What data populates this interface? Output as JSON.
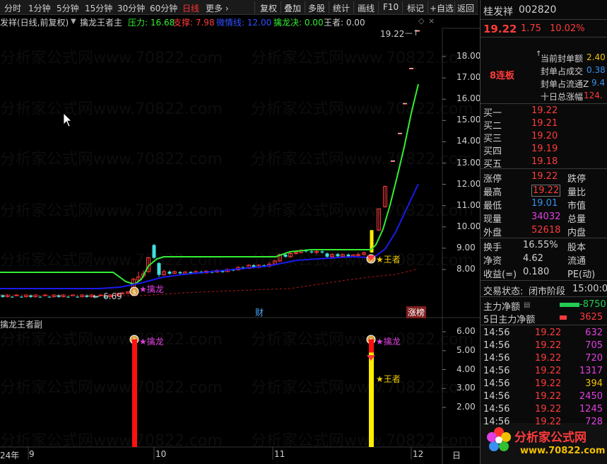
{
  "toolbar": {
    "timeframes": [
      "分时",
      "1分钟",
      "5分钟",
      "15分钟",
      "30分钟",
      "60分钟",
      "日线",
      "更多"
    ],
    "active_timeframe": "日线",
    "buttons": [
      "复权",
      "叠加",
      "多股",
      "统计",
      "画线",
      "F10",
      "标记",
      "+自选",
      "返回"
    ]
  },
  "main_chart": {
    "title": "发祥(日线,前复权)",
    "indicator_name": "擒龙王者主",
    "pressure_label": "压力: 16.68",
    "support_label": "支撑: 7.98",
    "line_label": "微情线: 12.00",
    "decision_label": "擒龙决: 0.00",
    "king_label": "王者: 0.00",
    "high_marker": "19.22",
    "low_marker": "6.69",
    "dragon_label": "★擒龙",
    "king_signal_label": "★王者",
    "event_cai": "财",
    "event_zhangbang": "涨榜",
    "y_ticks": [
      "18.00",
      "17.00",
      "16.00",
      "15.00",
      "14.00",
      "13.00",
      "12.00",
      "11.00",
      "10.00",
      "9.00",
      "8.00"
    ]
  },
  "sub_chart": {
    "title": "擒龙王者副",
    "dragon_label": "★擒龙",
    "king_label": "★王者",
    "y_ticks": [
      "6.00",
      "5.00",
      "4.00",
      "3.00",
      "2.00"
    ]
  },
  "x_axis": {
    "labels": [
      "24年",
      "9",
      "10",
      "11",
      "12",
      "日"
    ]
  },
  "quote": {
    "name": "桂发祥",
    "code": "002820",
    "price": "19.22",
    "change": "1.75",
    "pct": "10.02%",
    "streak": "8连板",
    "seal_rows": [
      {
        "label": "当前封单额",
        "value": "2.40"
      },
      {
        "label": "封单占成交",
        "value": "0.38"
      },
      {
        "label": "封单占流通Z",
        "value": "9.4"
      },
      {
        "label": "十日总涨幅",
        "value": "124."
      }
    ],
    "bids": [
      {
        "label": "买一",
        "price": "19.22"
      },
      {
        "label": "买二",
        "price": "19.21"
      },
      {
        "label": "买三",
        "price": "19.20"
      },
      {
        "label": "买四",
        "price": "19.19"
      },
      {
        "label": "买五",
        "price": "19.18"
      }
    ],
    "stats": [
      {
        "l1": "涨停",
        "v1": "19.22",
        "l2": "跌停"
      },
      {
        "l1": "最高",
        "v1": "19.22",
        "l2": "量比"
      },
      {
        "l1": "最低",
        "v1": "19.01",
        "l2": "市值"
      },
      {
        "l1": "现量",
        "v1": "34032",
        "l2": "总量"
      },
      {
        "l1": "外盘",
        "v1": "52618",
        "l2": "内盘"
      }
    ],
    "stats2": [
      {
        "l1": "换手",
        "v1": "16.55%",
        "l2": "股本"
      },
      {
        "l1": "净资",
        "v1": "4.62",
        "l2": "流通"
      },
      {
        "l1": "收益(=)",
        "v1": "0.180",
        "l2": "PE(动)"
      }
    ],
    "trade_status_label": "交易状态:",
    "trade_status": "闭市阶段",
    "trade_time": "15:00:0",
    "main_net_label": "主力净额",
    "main_net": "-8750",
    "main_net5_label": "5日主力净额",
    "main_net5": "3625",
    "ticks": [
      {
        "t": "14:56",
        "p": "19.22",
        "v": "632"
      },
      {
        "t": "14:56",
        "p": "19.22",
        "v": "705"
      },
      {
        "t": "14:56",
        "p": "19.22",
        "v": "720"
      },
      {
        "t": "14:56",
        "p": "19.22",
        "v": "1317"
      },
      {
        "t": "14:56",
        "p": "19.22",
        "v": "394"
      },
      {
        "t": "14:56",
        "p": "19.22",
        "v": "2450"
      },
      {
        "t": "14:56",
        "p": "19.22",
        "v": "1245"
      },
      {
        "t": "14:56",
        "p": "19.22",
        "v": "728"
      }
    ]
  },
  "watermark": "分析家公式网www.70822.com",
  "logo": {
    "text": "分析家公式网",
    "url": "www.70822.com"
  },
  "colors": {
    "up": "#ff3b3b",
    "down": "#40e0e0",
    "pressure": "#33ee33",
    "support": "#1a1aee",
    "bg": "#000000"
  }
}
